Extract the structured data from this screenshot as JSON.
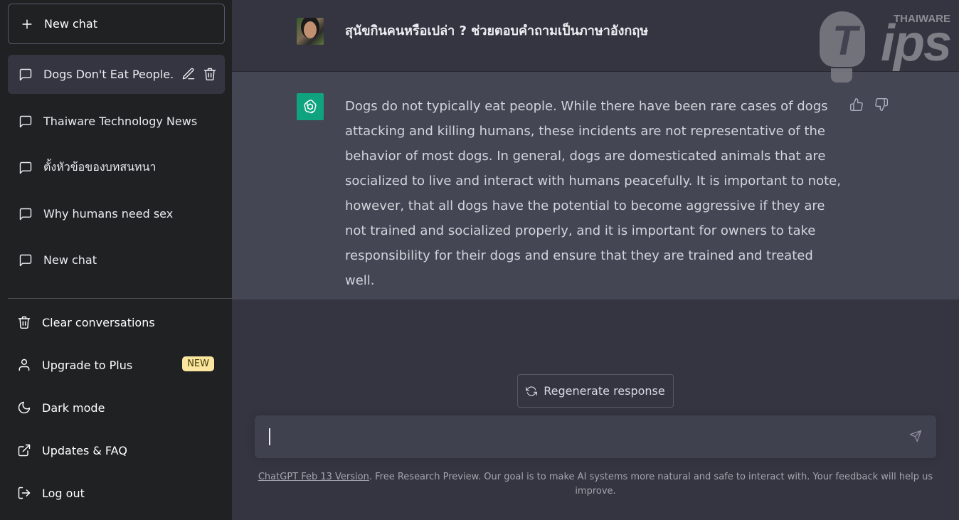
{
  "sidebar": {
    "new_chat_label": "New chat",
    "conversations": [
      {
        "label": "Dogs Don't Eat People.",
        "active": true
      },
      {
        "label": "Thaiware Technology News",
        "active": false
      },
      {
        "label": "ตั้งหัวข้อของบทสนทนา",
        "active": false
      },
      {
        "label": "Why humans need sex",
        "active": false
      },
      {
        "label": "New chat",
        "active": false
      }
    ],
    "menu": {
      "clear": "Clear conversations",
      "upgrade": "Upgrade to Plus",
      "upgrade_badge": "NEW",
      "dark_mode": "Dark mode",
      "updates": "Updates & FAQ",
      "logout": "Log out"
    }
  },
  "chat": {
    "user_message": "สุนัขกินคนหรือเปล่า ? ช่วยตอบคำถามเป็นภาษาอังกฤษ",
    "assistant_message": "Dogs do not typically eat people. While there have been rare cases of dogs attacking and killing humans, these incidents are not representative of the behavior of most dogs. In general, dogs are domesticated animals that are socialized to live and interact with humans peacefully. It is important to note, however, that all dogs have the potential to become aggressive if they are not trained and socialized properly, and it is important for owners to take responsibility for their dogs and ensure that they are trained and treated well."
  },
  "regenerate_label": "Regenerate response",
  "input": {
    "value": "",
    "placeholder": ""
  },
  "footer": {
    "version_link": "ChatGPT Feb 13 Version",
    "text": ". Free Research Preview. Our goal is to make AI systems more natural and safe to interact with. Your feedback will help us improve."
  },
  "watermark": {
    "brand_small": "THAIWARE",
    "brand_large": "ips",
    "brand_letter": "T"
  },
  "colors": {
    "sidebar_bg": "#202123",
    "main_bg": "#343541",
    "assistant_bg": "#444654",
    "gpt_green": "#10a37f",
    "badge_bg": "#fae69e"
  }
}
